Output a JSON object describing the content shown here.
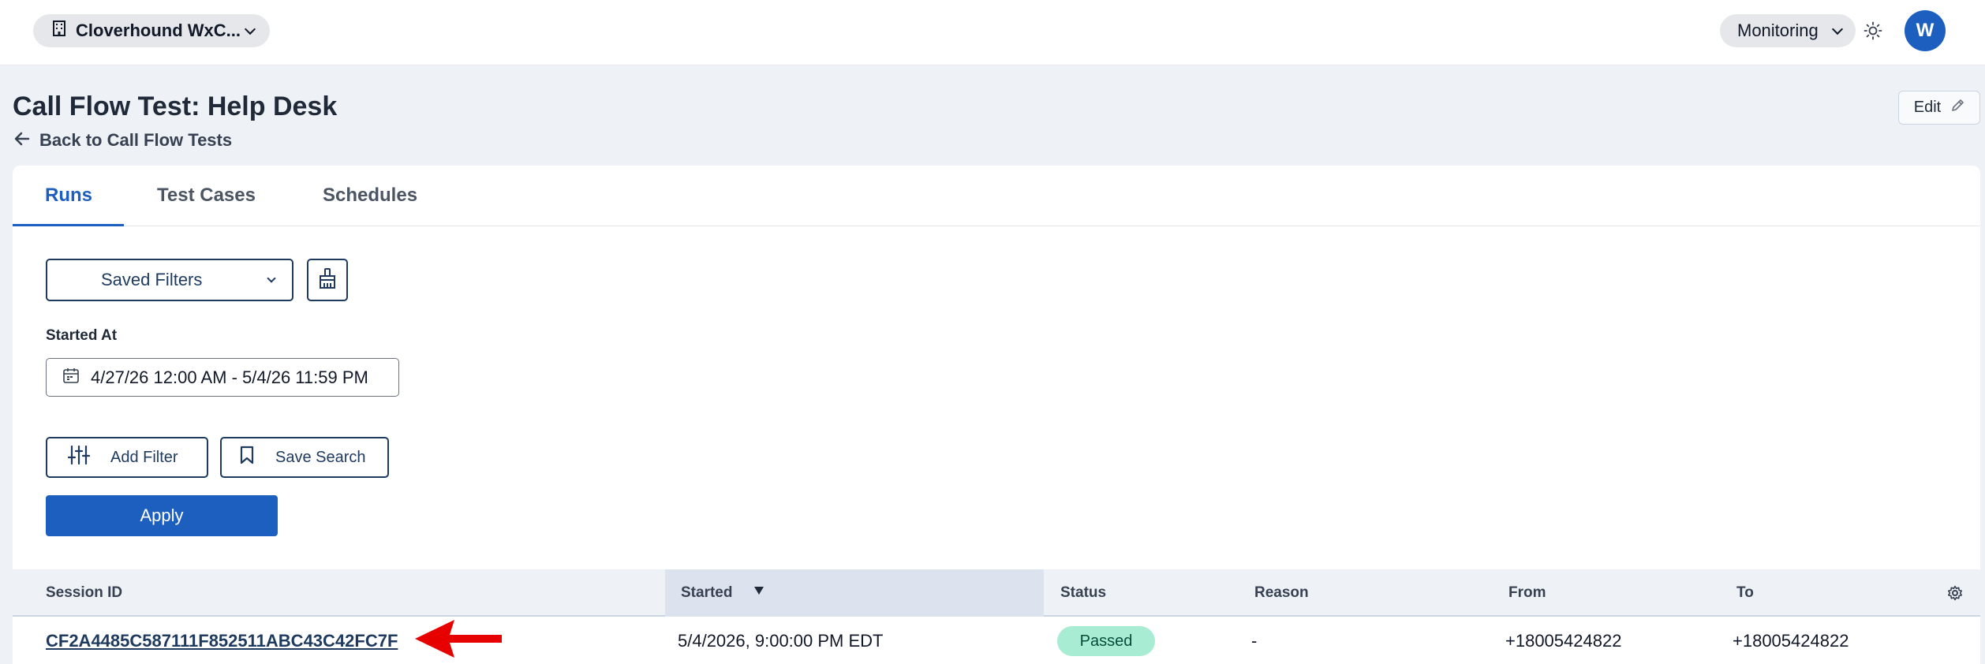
{
  "topbar": {
    "org_name": "Cloverhound WxC...",
    "module": "Monitoring",
    "avatar_initial": "W"
  },
  "header": {
    "title": "Call Flow Test: Help Desk",
    "back_link": "Back to Call Flow Tests",
    "edit_label": "Edit"
  },
  "tabs": [
    {
      "label": "Runs",
      "active": true
    },
    {
      "label": "Test Cases",
      "active": false
    },
    {
      "label": "Schedules",
      "active": false
    }
  ],
  "filters": {
    "saved_filters_label": "Saved Filters",
    "started_at_label": "Started At",
    "date_range": "4/27/26 12:00 AM - 5/4/26 11:59 PM",
    "add_filter_label": "Add Filter",
    "save_search_label": "Save Search",
    "apply_label": "Apply"
  },
  "table": {
    "columns": [
      "Session ID",
      "Started",
      "Status",
      "Reason",
      "From",
      "To"
    ],
    "sort_column": "Started",
    "rows": [
      {
        "session_id": "CF2A4485C587111F852511ABC43C42FC7F",
        "started": "5/4/2026, 9:00:00 PM EDT",
        "status": "Passed",
        "reason": "-",
        "from": "+18005424822",
        "to": "+18005424822"
      }
    ]
  },
  "colors": {
    "primary": "#1d5fbf",
    "navy": "#1e3a5f",
    "passed_badge": "#a7ecd3",
    "annotation_arrow": "#e60000"
  },
  "icons": [
    "building-icon",
    "chevron-down-icon",
    "sun-icon",
    "arrow-left-icon",
    "pencil-icon",
    "brush-icon",
    "calendar-icon",
    "sliders-icon",
    "bookmark-icon",
    "sort-desc-icon",
    "gear-icon"
  ]
}
